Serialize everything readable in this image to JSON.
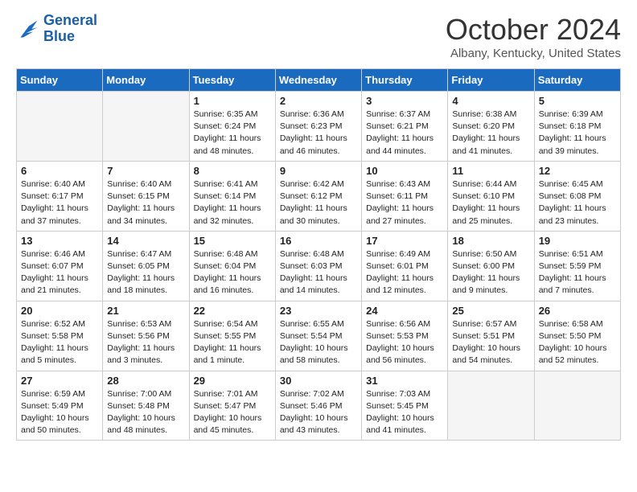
{
  "header": {
    "logo_line1": "General",
    "logo_line2": "Blue",
    "month": "October 2024",
    "location": "Albany, Kentucky, United States"
  },
  "weekdays": [
    "Sunday",
    "Monday",
    "Tuesday",
    "Wednesday",
    "Thursday",
    "Friday",
    "Saturday"
  ],
  "weeks": [
    [
      {
        "day": "",
        "sunrise": "",
        "sunset": "",
        "daylight": "",
        "empty": true
      },
      {
        "day": "",
        "sunrise": "",
        "sunset": "",
        "daylight": "",
        "empty": true
      },
      {
        "day": "1",
        "sunrise": "Sunrise: 6:35 AM",
        "sunset": "Sunset: 6:24 PM",
        "daylight": "Daylight: 11 hours and 48 minutes."
      },
      {
        "day": "2",
        "sunrise": "Sunrise: 6:36 AM",
        "sunset": "Sunset: 6:23 PM",
        "daylight": "Daylight: 11 hours and 46 minutes."
      },
      {
        "day": "3",
        "sunrise": "Sunrise: 6:37 AM",
        "sunset": "Sunset: 6:21 PM",
        "daylight": "Daylight: 11 hours and 44 minutes."
      },
      {
        "day": "4",
        "sunrise": "Sunrise: 6:38 AM",
        "sunset": "Sunset: 6:20 PM",
        "daylight": "Daylight: 11 hours and 41 minutes."
      },
      {
        "day": "5",
        "sunrise": "Sunrise: 6:39 AM",
        "sunset": "Sunset: 6:18 PM",
        "daylight": "Daylight: 11 hours and 39 minutes."
      }
    ],
    [
      {
        "day": "6",
        "sunrise": "Sunrise: 6:40 AM",
        "sunset": "Sunset: 6:17 PM",
        "daylight": "Daylight: 11 hours and 37 minutes."
      },
      {
        "day": "7",
        "sunrise": "Sunrise: 6:40 AM",
        "sunset": "Sunset: 6:15 PM",
        "daylight": "Daylight: 11 hours and 34 minutes."
      },
      {
        "day": "8",
        "sunrise": "Sunrise: 6:41 AM",
        "sunset": "Sunset: 6:14 PM",
        "daylight": "Daylight: 11 hours and 32 minutes."
      },
      {
        "day": "9",
        "sunrise": "Sunrise: 6:42 AM",
        "sunset": "Sunset: 6:12 PM",
        "daylight": "Daylight: 11 hours and 30 minutes."
      },
      {
        "day": "10",
        "sunrise": "Sunrise: 6:43 AM",
        "sunset": "Sunset: 6:11 PM",
        "daylight": "Daylight: 11 hours and 27 minutes."
      },
      {
        "day": "11",
        "sunrise": "Sunrise: 6:44 AM",
        "sunset": "Sunset: 6:10 PM",
        "daylight": "Daylight: 11 hours and 25 minutes."
      },
      {
        "day": "12",
        "sunrise": "Sunrise: 6:45 AM",
        "sunset": "Sunset: 6:08 PM",
        "daylight": "Daylight: 11 hours and 23 minutes."
      }
    ],
    [
      {
        "day": "13",
        "sunrise": "Sunrise: 6:46 AM",
        "sunset": "Sunset: 6:07 PM",
        "daylight": "Daylight: 11 hours and 21 minutes."
      },
      {
        "day": "14",
        "sunrise": "Sunrise: 6:47 AM",
        "sunset": "Sunset: 6:05 PM",
        "daylight": "Daylight: 11 hours and 18 minutes."
      },
      {
        "day": "15",
        "sunrise": "Sunrise: 6:48 AM",
        "sunset": "Sunset: 6:04 PM",
        "daylight": "Daylight: 11 hours and 16 minutes."
      },
      {
        "day": "16",
        "sunrise": "Sunrise: 6:48 AM",
        "sunset": "Sunset: 6:03 PM",
        "daylight": "Daylight: 11 hours and 14 minutes."
      },
      {
        "day": "17",
        "sunrise": "Sunrise: 6:49 AM",
        "sunset": "Sunset: 6:01 PM",
        "daylight": "Daylight: 11 hours and 12 minutes."
      },
      {
        "day": "18",
        "sunrise": "Sunrise: 6:50 AM",
        "sunset": "Sunset: 6:00 PM",
        "daylight": "Daylight: 11 hours and 9 minutes."
      },
      {
        "day": "19",
        "sunrise": "Sunrise: 6:51 AM",
        "sunset": "Sunset: 5:59 PM",
        "daylight": "Daylight: 11 hours and 7 minutes."
      }
    ],
    [
      {
        "day": "20",
        "sunrise": "Sunrise: 6:52 AM",
        "sunset": "Sunset: 5:58 PM",
        "daylight": "Daylight: 11 hours and 5 minutes."
      },
      {
        "day": "21",
        "sunrise": "Sunrise: 6:53 AM",
        "sunset": "Sunset: 5:56 PM",
        "daylight": "Daylight: 11 hours and 3 minutes."
      },
      {
        "day": "22",
        "sunrise": "Sunrise: 6:54 AM",
        "sunset": "Sunset: 5:55 PM",
        "daylight": "Daylight: 11 hours and 1 minute."
      },
      {
        "day": "23",
        "sunrise": "Sunrise: 6:55 AM",
        "sunset": "Sunset: 5:54 PM",
        "daylight": "Daylight: 10 hours and 58 minutes."
      },
      {
        "day": "24",
        "sunrise": "Sunrise: 6:56 AM",
        "sunset": "Sunset: 5:53 PM",
        "daylight": "Daylight: 10 hours and 56 minutes."
      },
      {
        "day": "25",
        "sunrise": "Sunrise: 6:57 AM",
        "sunset": "Sunset: 5:51 PM",
        "daylight": "Daylight: 10 hours and 54 minutes."
      },
      {
        "day": "26",
        "sunrise": "Sunrise: 6:58 AM",
        "sunset": "Sunset: 5:50 PM",
        "daylight": "Daylight: 10 hours and 52 minutes."
      }
    ],
    [
      {
        "day": "27",
        "sunrise": "Sunrise: 6:59 AM",
        "sunset": "Sunset: 5:49 PM",
        "daylight": "Daylight: 10 hours and 50 minutes."
      },
      {
        "day": "28",
        "sunrise": "Sunrise: 7:00 AM",
        "sunset": "Sunset: 5:48 PM",
        "daylight": "Daylight: 10 hours and 48 minutes."
      },
      {
        "day": "29",
        "sunrise": "Sunrise: 7:01 AM",
        "sunset": "Sunset: 5:47 PM",
        "daylight": "Daylight: 10 hours and 45 minutes."
      },
      {
        "day": "30",
        "sunrise": "Sunrise: 7:02 AM",
        "sunset": "Sunset: 5:46 PM",
        "daylight": "Daylight: 10 hours and 43 minutes."
      },
      {
        "day": "31",
        "sunrise": "Sunrise: 7:03 AM",
        "sunset": "Sunset: 5:45 PM",
        "daylight": "Daylight: 10 hours and 41 minutes."
      },
      {
        "day": "",
        "sunrise": "",
        "sunset": "",
        "daylight": "",
        "empty": true
      },
      {
        "day": "",
        "sunrise": "",
        "sunset": "",
        "daylight": "",
        "empty": true
      }
    ]
  ]
}
